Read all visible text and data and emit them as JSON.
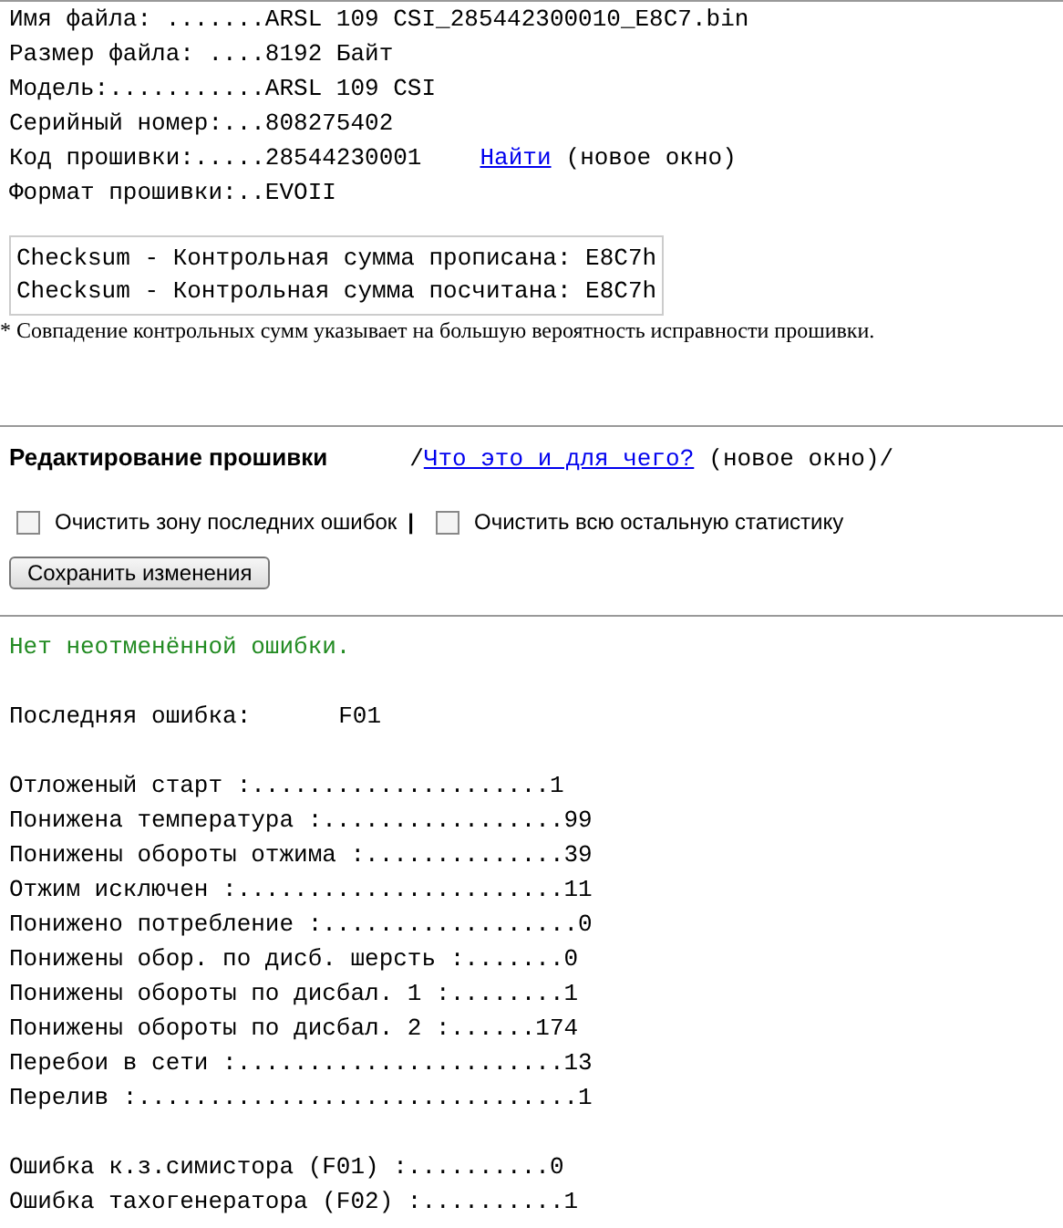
{
  "file_info": [
    "Имя файла: .......ARSL 109 CSI_285442300010_E8C7.bin",
    "Размер файла: ....8192 Байт",
    "Модель:...........ARSL 109 CSI",
    "Серийный номер:...808275402"
  ],
  "firmware_code": {
    "text": "Код прошивки:.....28544230001",
    "link": "Найти",
    "note": "(новое окно)"
  },
  "firmware_format": "Формат прошивки:..EVOII",
  "checksums": [
    "Checksum - Контрольная сумма прописана: E8C7h",
    "Checksum - Контрольная сумма посчитана: E8C7h"
  ],
  "checksum_note": "* Совпадение контрольных сумм указывает на большую вероятность исправности прошивки.",
  "editing": {
    "title": "Редактирование прошивки",
    "slash_left": "/",
    "link": "Что это и для чего?",
    "note": "(новое окно)",
    "slash_right": "/"
  },
  "checkboxes": [
    {
      "label": "Очистить зону последних ошибок",
      "checked": false
    },
    {
      "label": "Очистить всю остальную статистику",
      "checked": false
    }
  ],
  "separator": "|",
  "save_button": "Сохранить изменения",
  "status": "Нет неотменённой ошибки.",
  "last_error": {
    "label": "Последняя ошибка:",
    "value": "F01"
  },
  "stat_groups": [
    [
      "Отложеный старт :.....................1",
      "Понижена температура :.................99",
      "Понижены обороты отжима :..............39",
      "Отжим исключен :.......................11",
      "Понижено потребление :..................0",
      "Понижены обор. по дисб. шерсть :.......0",
      "Понижены обороты по дисбал. 1 :........1",
      "Понижены обороты по дисбал. 2 :......174",
      "Перебои в сети :.......................13",
      "Перелив :...............................1"
    ],
    [
      "Ошибка к.з.симистора (F01) :..........0",
      "Ошибка тахогенератора (F02) :..........1"
    ]
  ]
}
